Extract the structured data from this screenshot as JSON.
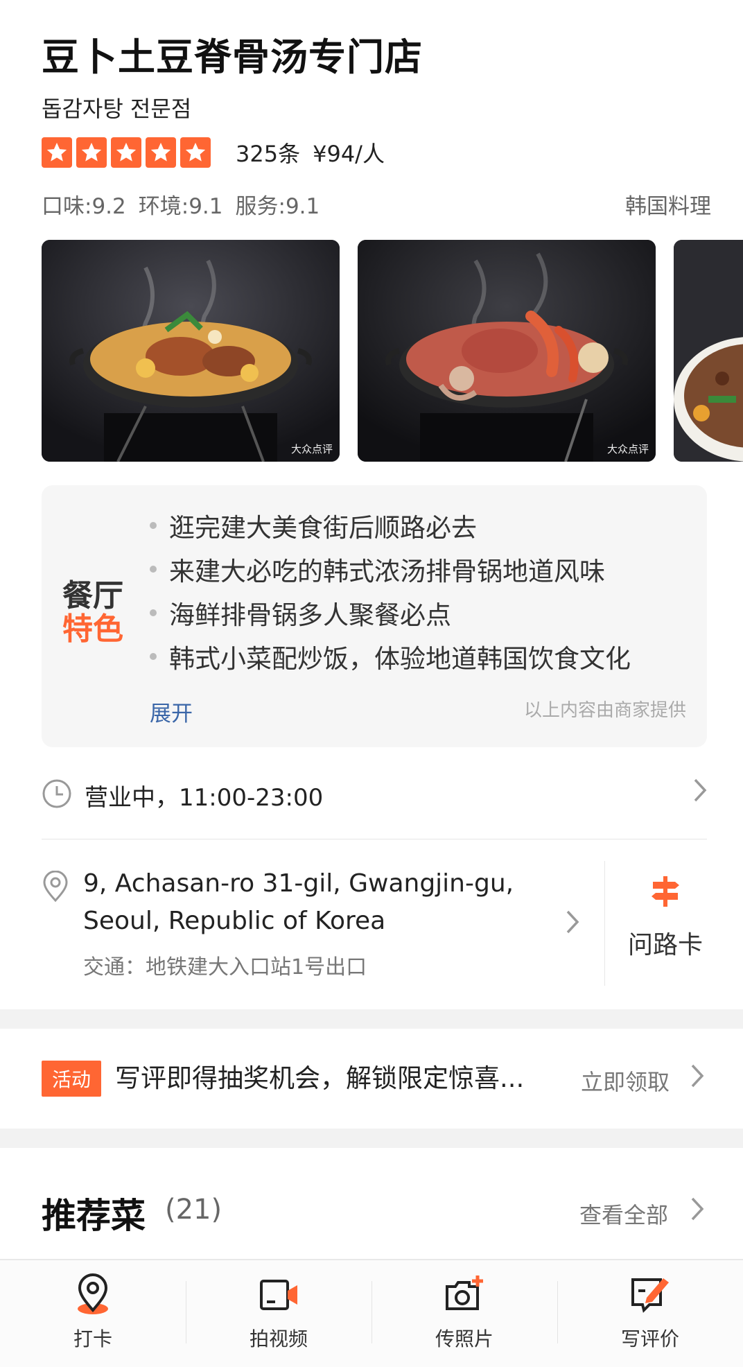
{
  "header": {
    "title": "豆卜土豆脊骨汤专门店",
    "subtitle": "돕감자탕 전문점",
    "rating_stars": 5,
    "review_count": "325条",
    "price_per_person": "¥94/人",
    "score_taste": "口味:9.2",
    "score_environment": "环境:9.1",
    "score_service": "服务:9.1",
    "category": "韩国料理"
  },
  "photos": {
    "watermark": "大众点评",
    "items": [
      "pork-bone-stew-photo",
      "seafood-stew-photo",
      "partial-dish-photo"
    ]
  },
  "features": {
    "badge_line1": "餐厅",
    "badge_line2": "特色",
    "items": [
      "逛完建大美食街后顺路必去",
      "来建大必吃的韩式浓汤排骨锅地道风味",
      "海鲜排骨锅多人聚餐必点",
      "韩式小菜配炒饭，体验地道韩国饮食文化"
    ],
    "expand_label": "展开",
    "provided_note": "以上内容由商家提供"
  },
  "hours": {
    "text": "营业中，11:00-23:00",
    "icon": "clock-icon"
  },
  "address": {
    "line1": "9, Achasan-ro 31-gil, Gwangjin-gu,",
    "line2": "Seoul, Republic of Korea",
    "transit": "交通：地铁建大入口站1号出口",
    "route_card_label": "问路卡",
    "icon": "location-pin-icon"
  },
  "promo": {
    "badge": "活动",
    "text": "写评即得抽奖机会，解锁限定惊喜...",
    "cta": "立即领取"
  },
  "recommended": {
    "title": "推荐菜",
    "count": "(21)",
    "view_all": "查看全部"
  },
  "bottom_bar": {
    "tabs": [
      {
        "label": "打卡",
        "icon": "checkin-pin-icon"
      },
      {
        "label": "拍视频",
        "icon": "video-camera-icon"
      },
      {
        "label": "传照片",
        "icon": "photo-camera-add-icon"
      },
      {
        "label": "写评价",
        "icon": "write-review-icon"
      }
    ]
  },
  "colors": {
    "accent": "#ff6633",
    "link": "#3a66a8",
    "text_primary": "#222222",
    "text_secondary": "#666666"
  }
}
